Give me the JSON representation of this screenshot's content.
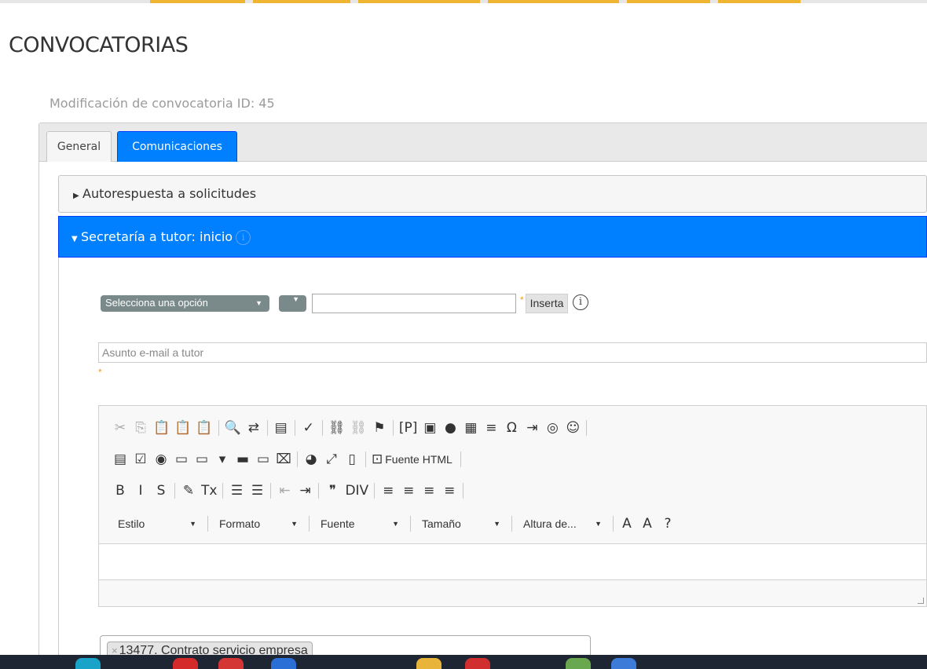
{
  "page": {
    "title": "CONVOCATORIAS",
    "subtitle": "Modificación de convocatoria ID: 45"
  },
  "tabs": [
    {
      "label": "General",
      "active": false
    },
    {
      "label": "Comunicaciones",
      "active": true
    }
  ],
  "accordion": [
    {
      "title": "Autorespuesta a solicitudes",
      "expanded": false
    },
    {
      "title": "Secretaría a tutor: inicio",
      "expanded": true
    }
  ],
  "form": {
    "select_placeholder": "Selecciona una opción",
    "field_value": "",
    "required_mark": "*",
    "insert_label": "Inserta",
    "info_symbol": "i",
    "subject_placeholder": "Asunto e-mail a tutor"
  },
  "editor": {
    "rows": [
      [
        {
          "icon": "cut-icon",
          "glyph": "✂",
          "dim": true
        },
        {
          "icon": "copy-icon",
          "glyph": "⎘",
          "dim": true
        },
        {
          "icon": "paste-icon",
          "glyph": "📋"
        },
        {
          "icon": "paste-text-icon",
          "glyph": "📋"
        },
        {
          "icon": "paste-word-icon",
          "glyph": "📋"
        },
        {
          "sep": true
        },
        {
          "icon": "find-icon",
          "glyph": "🔍"
        },
        {
          "icon": "replace-icon",
          "glyph": "⇄"
        },
        {
          "sep": true
        },
        {
          "icon": "select-all-icon",
          "glyph": "▤"
        },
        {
          "sep": true
        },
        {
          "icon": "spellcheck-icon",
          "glyph": "✓"
        },
        {
          "sep": true
        },
        {
          "icon": "link-icon",
          "glyph": "⛓"
        },
        {
          "icon": "unlink-icon",
          "glyph": "⛓",
          "dim": true
        },
        {
          "icon": "anchor-icon",
          "glyph": "⚑"
        },
        {
          "sep": true
        },
        {
          "icon": "placeholder-icon",
          "glyph": "[P]"
        },
        {
          "icon": "image-icon",
          "glyph": "▣"
        },
        {
          "icon": "flash-icon",
          "glyph": "●"
        },
        {
          "icon": "table-icon",
          "glyph": "▦"
        },
        {
          "icon": "hr-icon",
          "glyph": "≡"
        },
        {
          "icon": "special-char-icon",
          "glyph": "Ω"
        },
        {
          "icon": "indent-list-icon",
          "glyph": "⇥"
        },
        {
          "icon": "iframe-icon",
          "glyph": "◎"
        },
        {
          "icon": "smiley-icon",
          "glyph": "☺"
        },
        {
          "sep": true
        }
      ],
      [
        {
          "icon": "form-icon",
          "glyph": "▤"
        },
        {
          "icon": "checkbox-icon",
          "glyph": "☑"
        },
        {
          "icon": "radio-icon",
          "glyph": "◉"
        },
        {
          "icon": "textfield-icon",
          "glyph": "▭"
        },
        {
          "icon": "textarea-icon",
          "glyph": "▭"
        },
        {
          "icon": "select-field-icon",
          "glyph": "▾"
        },
        {
          "icon": "button-field-icon",
          "glyph": "▬"
        },
        {
          "icon": "image-button-icon",
          "glyph": "▭"
        },
        {
          "icon": "hidden-field-icon",
          "glyph": "⌧"
        },
        {
          "sep": true
        },
        {
          "icon": "templates-icon",
          "glyph": "◕"
        },
        {
          "icon": "maximize-icon",
          "glyph": "⤢"
        },
        {
          "icon": "show-blocks-icon",
          "glyph": "▯"
        },
        {
          "sep": true
        },
        {
          "icon": "source-icon",
          "glyph": "⊡",
          "text": "Fuente HTML"
        },
        {
          "sep": true
        }
      ],
      [
        {
          "icon": "bold-icon",
          "glyph": "B"
        },
        {
          "icon": "italic-icon",
          "glyph": "I"
        },
        {
          "icon": "strike-icon",
          "glyph": "S"
        },
        {
          "sep": true
        },
        {
          "icon": "copy-format-icon",
          "glyph": "✎"
        },
        {
          "icon": "remove-format-icon",
          "glyph": "Tx"
        },
        {
          "sep": true
        },
        {
          "icon": "numbered-list-icon",
          "glyph": "☰"
        },
        {
          "icon": "bulleted-list-icon",
          "glyph": "☰"
        },
        {
          "sep": true
        },
        {
          "icon": "outdent-icon",
          "glyph": "⇤",
          "dim": true
        },
        {
          "icon": "indent-icon",
          "glyph": "⇥"
        },
        {
          "sep": true
        },
        {
          "icon": "blockquote-icon",
          "glyph": "❞"
        },
        {
          "icon": "div-icon",
          "glyph": "DIV"
        },
        {
          "sep": true
        },
        {
          "icon": "align-left-icon",
          "glyph": "≡"
        },
        {
          "icon": "align-center-icon",
          "glyph": "≡"
        },
        {
          "icon": "align-right-icon",
          "glyph": "≡"
        },
        {
          "icon": "align-justify-icon",
          "glyph": "≡"
        },
        {
          "sep": true
        }
      ]
    ],
    "combos": [
      "Estilo",
      "Formato",
      "Fuente",
      "Tamaño",
      "Altura de..."
    ],
    "extra": [
      {
        "icon": "text-color-icon",
        "glyph": "A"
      },
      {
        "icon": "bg-color-icon",
        "glyph": "A"
      },
      {
        "icon": "help-icon",
        "glyph": "?"
      }
    ]
  },
  "tag": {
    "remove": "×",
    "label": "13477. Contrato servicio empresa"
  },
  "colors": {
    "accent": "#007fff",
    "tab_stub": "#f0b530",
    "required": "#f39c12",
    "taskbar": "#1f2633"
  }
}
